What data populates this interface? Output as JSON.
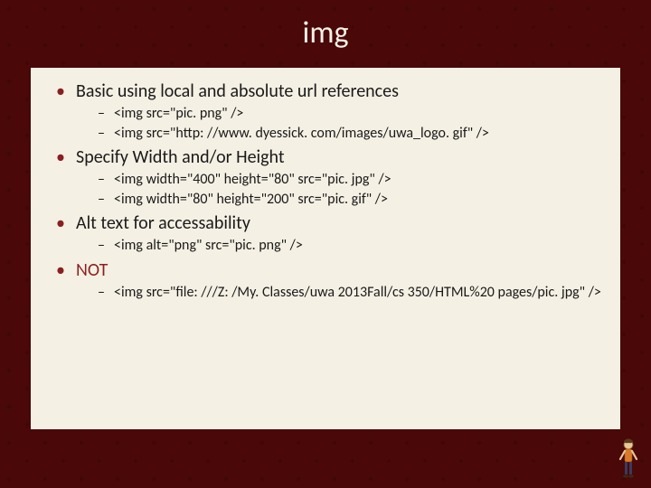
{
  "title": "img",
  "bullets": [
    {
      "label": "Basic using local and absolute url references",
      "emphasis": false,
      "sub": [
        "<img  src=\"pic. png\" />",
        "<img  src=\"http: //www. dyessick. com/images/uwa_logo. gif\" />"
      ]
    },
    {
      "label": "Specify Width and/or Height",
      "emphasis": false,
      "sub": [
        "<img width=\"400\" height=\"80\" src=\"pic. jpg\" />",
        "<img width=\"80\" height=\"200\" src=\"pic. gif\" />"
      ]
    },
    {
      "label": "Alt text for accessability",
      "emphasis": false,
      "sub": [
        "<img  alt=\"png\" src=\"pic. png\" />"
      ]
    },
    {
      "label": "NOT",
      "emphasis": true,
      "sub": [
        "<img src=\"file: ///Z: /My. Classes/uwa 2013Fall/cs 350/HTML%20 pages/pic. jpg\" />"
      ]
    }
  ]
}
